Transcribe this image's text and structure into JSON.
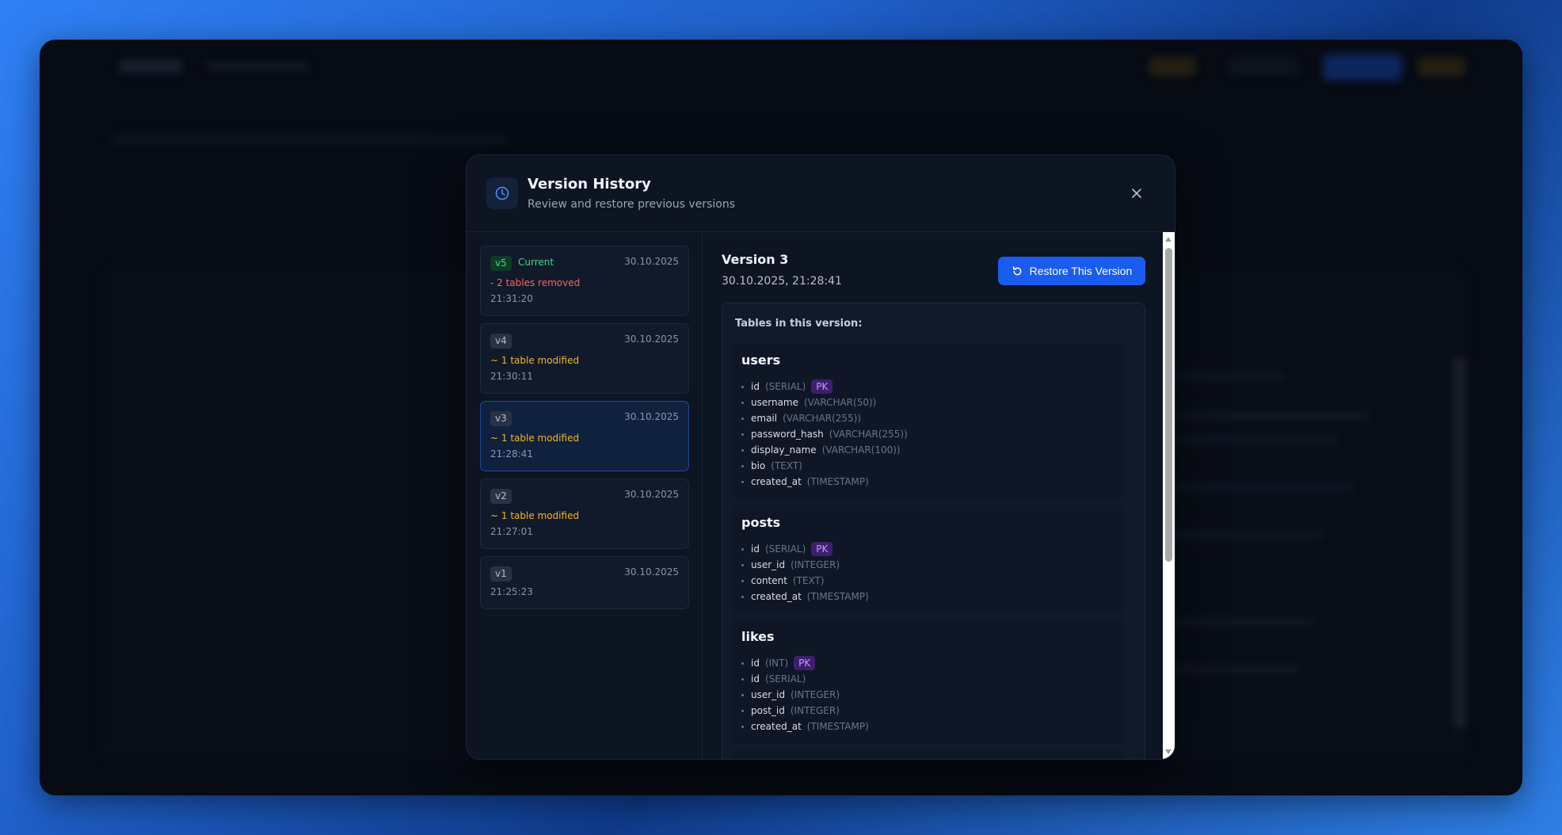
{
  "modal": {
    "title": "Version History",
    "subtitle": "Review and restore previous versions",
    "icon": "clock-icon",
    "close_icon": "close-icon"
  },
  "versions": [
    {
      "label": "v5",
      "current_label": "Current",
      "date": "30.10.2025",
      "change": "- 2 tables removed",
      "time": "21:31:20"
    },
    {
      "label": "v4",
      "date": "30.10.2025",
      "change": "~ 1 table modified",
      "time": "21:30:11"
    },
    {
      "label": "v3",
      "date": "30.10.2025",
      "change": "~ 1 table modified",
      "time": "21:28:41"
    },
    {
      "label": "v2",
      "date": "30.10.2025",
      "change": "~ 1 table modified",
      "time": "21:27:01"
    },
    {
      "label": "v1",
      "date": "30.10.2025",
      "time": "21:25:23"
    }
  ],
  "detail": {
    "title": "Version 3",
    "datetime": "30.10.2025, 21:28:41",
    "restore_label": "Restore This Version",
    "restore_icon": "restore-icon",
    "tables_heading": "Tables in this version:",
    "pk_label": "PK",
    "tables": [
      {
        "name": "users",
        "columns": [
          {
            "name": "id",
            "type": "(SERIAL)"
          },
          {
            "name": "username",
            "type": "(VARCHAR(50))"
          },
          {
            "name": "email",
            "type": "(VARCHAR(255))"
          },
          {
            "name": "password_hash",
            "type": "(VARCHAR(255))"
          },
          {
            "name": "display_name",
            "type": "(VARCHAR(100))"
          },
          {
            "name": "bio",
            "type": "(TEXT)"
          },
          {
            "name": "created_at",
            "type": "(TIMESTAMP)"
          }
        ]
      },
      {
        "name": "posts",
        "columns": [
          {
            "name": "id",
            "type": "(SERIAL)"
          },
          {
            "name": "user_id",
            "type": "(INTEGER)"
          },
          {
            "name": "content",
            "type": "(TEXT)"
          },
          {
            "name": "created_at",
            "type": "(TIMESTAMP)"
          }
        ]
      },
      {
        "name": "likes",
        "columns": [
          {
            "name": "id",
            "type": "(INT)"
          },
          {
            "name": "id",
            "type": "(SERIAL)"
          },
          {
            "name": "user_id",
            "type": "(INTEGER)"
          },
          {
            "name": "post_id",
            "type": "(INTEGER)"
          },
          {
            "name": "created_at",
            "type": "(TIMESTAMP)"
          }
        ]
      }
    ]
  },
  "colors": {
    "accent": "#1a5cf0",
    "current_green": "#3ddc84",
    "removed_red": "#f56565",
    "modified_amber": "#f5b523",
    "pk_purple": "#c39cff"
  }
}
